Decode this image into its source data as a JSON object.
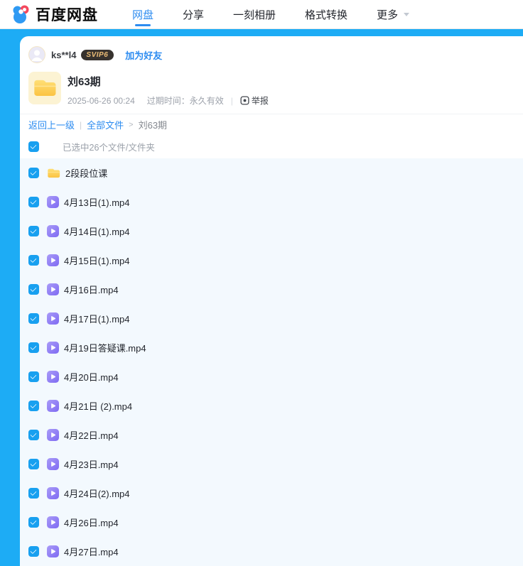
{
  "header": {
    "brand": "百度网盘",
    "nav": [
      {
        "label": "网盘",
        "active": true,
        "caret": false
      },
      {
        "label": "分享",
        "active": false,
        "caret": false
      },
      {
        "label": "一刻相册",
        "active": false,
        "caret": false
      },
      {
        "label": "格式转换",
        "active": false,
        "caret": false
      },
      {
        "label": "更多",
        "active": false,
        "caret": true
      }
    ]
  },
  "share": {
    "owner": "ks**l4",
    "badge": "SVIP6",
    "add_friend": "加为好友",
    "title": "刘63期",
    "date": "2025-06-26 00:24",
    "expire": "过期时间：永久有效",
    "report": "举报"
  },
  "breadcrumb": {
    "back": "返回上一级",
    "bar": "|",
    "all": "全部文件",
    "gt": ">",
    "current": "刘63期"
  },
  "selection": {
    "summary": "已选中26个文件/文件夹"
  },
  "files": [
    {
      "name": "2段段位课",
      "type": "folder"
    },
    {
      "name": "4月13日(1).mp4",
      "type": "video"
    },
    {
      "name": "4月14日(1).mp4",
      "type": "video"
    },
    {
      "name": "4月15日(1).mp4",
      "type": "video"
    },
    {
      "name": "4月16日.mp4",
      "type": "video"
    },
    {
      "name": "4月17日(1).mp4",
      "type": "video"
    },
    {
      "name": "4月19日答疑课.mp4",
      "type": "video"
    },
    {
      "name": "4月20日.mp4",
      "type": "video"
    },
    {
      "name": "4月21日 (2).mp4",
      "type": "video"
    },
    {
      "name": "4月22日.mp4",
      "type": "video"
    },
    {
      "name": "4月23日.mp4",
      "type": "video"
    },
    {
      "name": "4月24日(2).mp4",
      "type": "video"
    },
    {
      "name": "4月26日.mp4",
      "type": "video"
    },
    {
      "name": "4月27日.mp4",
      "type": "video"
    }
  ],
  "colors": {
    "theme_blue": "#1dacf5",
    "link_blue": "#2d8cf0",
    "checkbox_blue": "#18a0f0",
    "selected_row_bg": "#f3f9fe",
    "badge_bg": "#37322e",
    "badge_text": "#edbe77"
  }
}
